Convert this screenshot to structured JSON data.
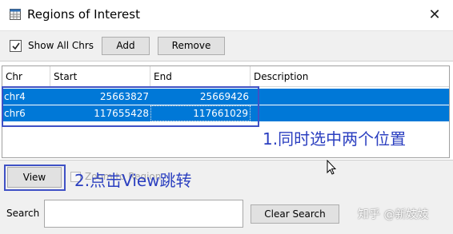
{
  "window": {
    "title": "Regions of Interest",
    "close_glyph": "✕",
    "icon": "grid-app-icon"
  },
  "toolbar": {
    "show_all_chrs_label": "Show All Chrs",
    "show_all_chrs_checked": true,
    "add_label": "Add",
    "remove_label": "Remove"
  },
  "table": {
    "headers": [
      "Chr",
      "Start",
      "End",
      "Description"
    ],
    "rows": [
      {
        "chr": "chr4",
        "start": "25663827",
        "end": "25669426",
        "description": ""
      },
      {
        "chr": "chr6",
        "start": "117655428",
        "end": "117661029",
        "description": ""
      }
    ],
    "selection_color": "#0078d7"
  },
  "annotations": {
    "note1": "1.同时选中两个位置",
    "note2": "2.点击View跳转",
    "color": "#3f51c5"
  },
  "bottom": {
    "view_label": "View",
    "zoom_label": "Zoom to Region",
    "zoom_checked": false,
    "search_label": "Search",
    "search_value": "",
    "clear_label": "Clear Search"
  },
  "watermark": "知乎 @新妓妓"
}
